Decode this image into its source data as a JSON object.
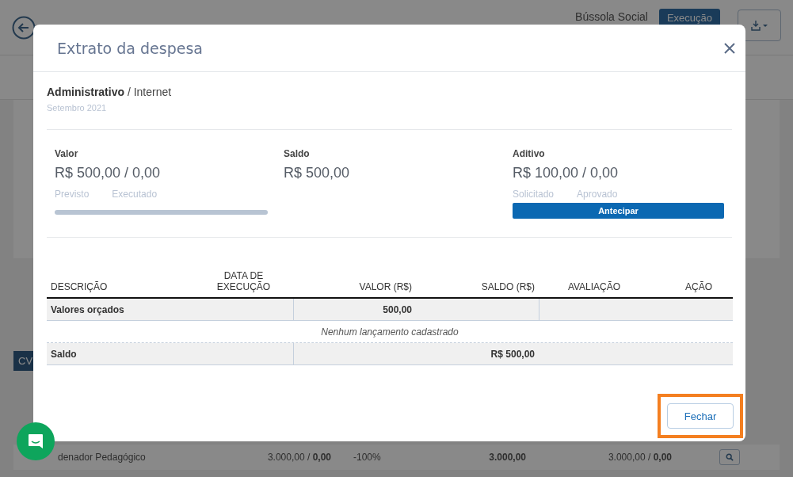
{
  "background": {
    "org_name": "Bússola Social",
    "status_badge": "Execução",
    "side_header": "CV",
    "row": {
      "columns": [
        "denador Pedagógico",
        "3.000,00 / **0,00**",
        "-100%",
        "3.000,00",
        "3.000,00 / **0,00**"
      ]
    }
  },
  "modal": {
    "title": "Extrato da despesa",
    "breadcrumb": "**Administrativo** / Internet",
    "period": "Setembro 2021",
    "stats": [
      {
        "kind": "progress",
        "label": "Valor",
        "value": "R$ 500,00 / 0,00",
        "sublabels": [
          "Previsto",
          "Executado"
        ],
        "level": 0
      },
      {
        "kind": "plain",
        "label": "Saldo",
        "value": "R$ 500,00"
      },
      {
        "kind": "action",
        "label": "Aditivo",
        "value": "R$ 100,00 / 0,00",
        "sublabels": [
          "Solicitado",
          "Aprovado"
        ],
        "button": "Antecipar"
      }
    ],
    "table": {
      "columns": [
        "DESCRIÇÃO",
        "DATA DE EXECUÇÃO",
        "VALOR (R$)",
        "SALDO (R$)",
        "AVALIAÇÃO",
        "AÇÃO"
      ],
      "rows": [
        {
          "kind": "budget",
          "label": "Valores orçados",
          "value": "500,00"
        },
        {
          "kind": "empty",
          "label": "Nenhum lançamento cadastrado"
        },
        {
          "kind": "balance",
          "label": "Saldo",
          "value": "R$ 500,00"
        }
      ]
    },
    "close_button": {
      "label": "Fechar",
      "highlighted": true
    }
  }
}
